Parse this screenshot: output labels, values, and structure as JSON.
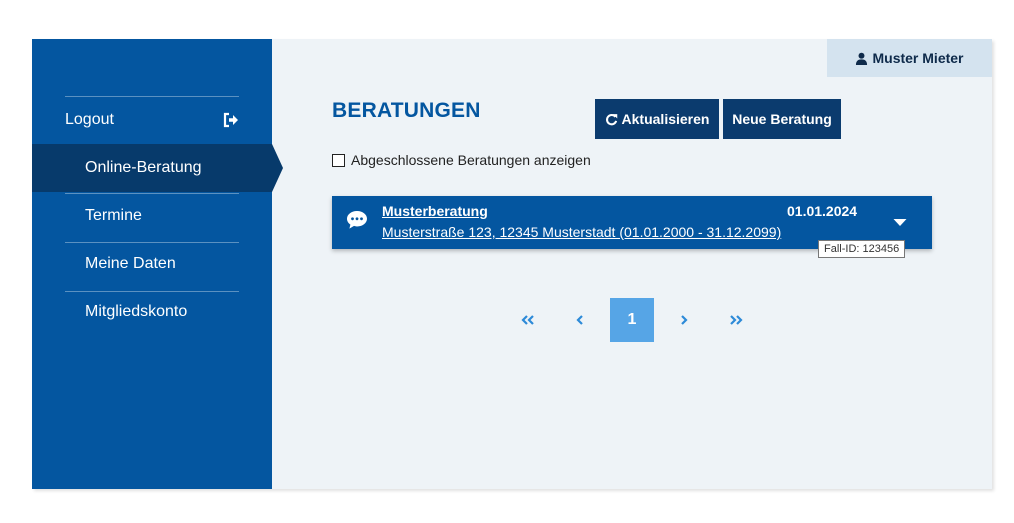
{
  "sidebar": {
    "items": [
      {
        "label": "Logout",
        "icon": "logout-icon"
      },
      {
        "label": "Online-Beratung",
        "active": true
      },
      {
        "label": "Termine"
      },
      {
        "label": "Meine Daten"
      },
      {
        "label": "Mitgliedskonto"
      }
    ]
  },
  "header": {
    "user_name": "Muster Mieter",
    "user_icon": "user-icon"
  },
  "main": {
    "title": "BERATUNGEN",
    "refresh_label": "Aktualisieren",
    "new_label": "Neue Beratung",
    "show_closed_label": "Abgeschlossene Beratungen anzeigen",
    "show_closed_checked": false
  },
  "cases": [
    {
      "title": "Musterberatung",
      "address": "Musterstraße 123, 12345 Musterstadt (01.01.2000 - 31.12.2099)",
      "date": "01.01.2024",
      "icon": "chat-icon",
      "tooltip": "Fall-ID: 123456"
    }
  ],
  "pagination": {
    "current": "1"
  },
  "colors": {
    "sidebar": "#0456a0",
    "active_nav": "#073a6b",
    "button": "#0b3b6e",
    "content_bg": "#eef3f7",
    "user_chip": "#d4e3ef",
    "pager_active": "#56a5e6",
    "pager_link": "#2d8ad8"
  }
}
